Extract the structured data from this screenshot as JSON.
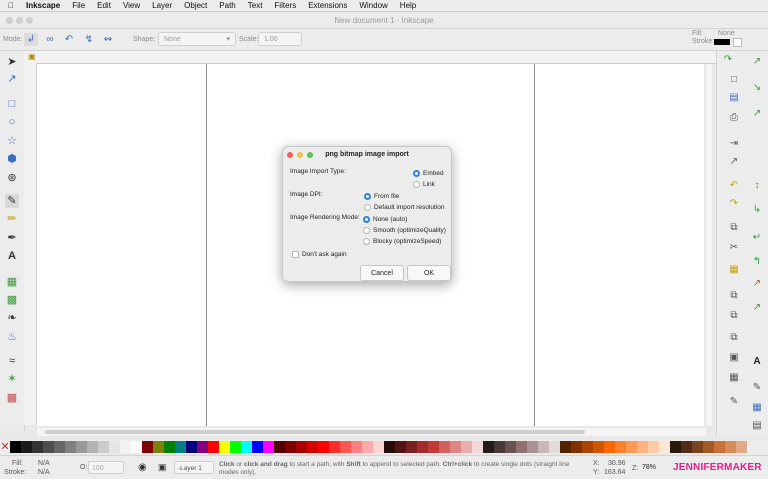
{
  "menubar": {
    "apple": "",
    "items": [
      "Inkscape",
      "File",
      "Edit",
      "View",
      "Layer",
      "Object",
      "Path",
      "Text",
      "Filters",
      "Extensions",
      "Window",
      "Help"
    ]
  },
  "window": {
    "title": "New document 1 - Inkscape"
  },
  "controls": {
    "mode_label": "Mode:",
    "shape_label": "Shape:",
    "shape_value": "None",
    "scale_label": "Scale:",
    "scale_value": "1.00",
    "fill_label": "Fill:",
    "fill_value": "None",
    "stroke_label": "Stroke:"
  },
  "dialog": {
    "title": "png bitmap image import",
    "import_type_label": "Image Import Type:",
    "embed": "Embed",
    "link": "Link",
    "dpi_label": "Image DPI:",
    "from_file": "From file",
    "default_res": "Default import resolution",
    "render_label": "Image Rendering Mode:",
    "none_auto": "None (auto)",
    "smooth": "Smooth (optimizeQuality)",
    "blocky": "Blocky (optimizeSpeed)",
    "dont_ask": "Don't ask again",
    "cancel": "Cancel",
    "ok": "OK"
  },
  "status": {
    "fill_label": "Fill:",
    "fill_value": "N/A",
    "stroke_label": "Stroke:",
    "stroke_value": "N/A",
    "opacity_label": "O:",
    "opacity_value": "100",
    "layer": "-Layer 1",
    "message_bold1": "Click",
    "message_1": " or ",
    "message_bold2": "click and drag",
    "message_2": " to start a path; with ",
    "message_bold3": "Shift",
    "message_3": " to append to selected path. ",
    "message_bold4": "Ctrl+click",
    "message_4": " to create single dots (straight line modes only).",
    "x_label": "X:",
    "x_value": "30.96",
    "y_label": "Y:",
    "y_value": "163.64",
    "zoom_label": "Z:",
    "zoom_value": "78%",
    "brand": "JENNIFERMAKER"
  },
  "colors": {
    "accent": "#2b7ee3",
    "brand": "#e0218a",
    "palette": [
      "#000000",
      "#1a1a1a",
      "#333333",
      "#4d4d4d",
      "#666666",
      "#808080",
      "#999999",
      "#b3b3b3",
      "#cccccc",
      "#e6e6e6",
      "#f2f2f2",
      "#ffffff",
      "#800000",
      "#808000",
      "#008000",
      "#008080",
      "#000080",
      "#800080",
      "#ff0000",
      "#ffff00",
      "#00ff00",
      "#00ffff",
      "#0000ff",
      "#ff00ff",
      "#550000",
      "#800000",
      "#aa0000",
      "#d40000",
      "#ff0000",
      "#ff2a2a",
      "#ff5555",
      "#ff8080",
      "#ffaaaa",
      "#ffd5d5",
      "#280b0b",
      "#501616",
      "#782121",
      "#a02c2c",
      "#c83737",
      "#d35f5f",
      "#de8787",
      "#e9afaf",
      "#f4d7d7",
      "#241c1c",
      "#483737",
      "#6c5353",
      "#916f6f",
      "#ac9393",
      "#c8b7b7",
      "#e3dbdb",
      "#552200",
      "#803300",
      "#aa4400",
      "#d45500",
      "#ff6600",
      "#ff7f2a",
      "#ff9955",
      "#ffb380",
      "#ffccaa",
      "#ffe6d5",
      "#28170b",
      "#502d16",
      "#784421",
      "#a05a2c",
      "#c87137",
      "#d38d5f",
      "#deaa87"
    ]
  }
}
